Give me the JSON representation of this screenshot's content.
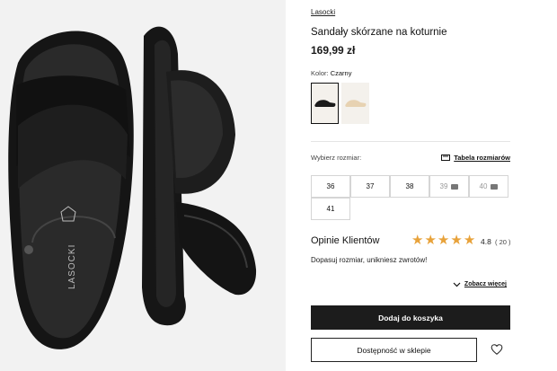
{
  "product": {
    "brand": "Lasocki",
    "title": "Sandały skórzane na koturnie",
    "price": "169,99 zł",
    "gallery_logo": "LASOCKI"
  },
  "color": {
    "label": "Kolor:",
    "value": "Czarny",
    "swatches": [
      {
        "name": "black",
        "selected": true,
        "hex": "#1b1b1b"
      },
      {
        "name": "beige",
        "selected": false,
        "hex": "#e7d2b2"
      }
    ]
  },
  "size": {
    "label": "Wybierz rozmiar:",
    "chart_link": "Tabela rozmiarów",
    "options": [
      {
        "label": "36",
        "available": true
      },
      {
        "label": "37",
        "available": true
      },
      {
        "label": "38",
        "available": true
      },
      {
        "label": "39",
        "available": false
      },
      {
        "label": "40",
        "available": false
      },
      {
        "label": "41",
        "available": true
      }
    ]
  },
  "reviews": {
    "title": "Opinie Klientów",
    "rating": "4.8",
    "count": "( 20 )",
    "stars_filled": 5,
    "fit_message": "Dopasuj rozmiar, unikniesz zwrotów!",
    "see_more": "Zobacz więcej"
  },
  "actions": {
    "add_to_cart": "Dodaj do koszyka",
    "store_availability": "Dostępność w sklepie"
  },
  "colors": {
    "star": "#e8a23a",
    "button_dark": "#1c1c1c"
  }
}
